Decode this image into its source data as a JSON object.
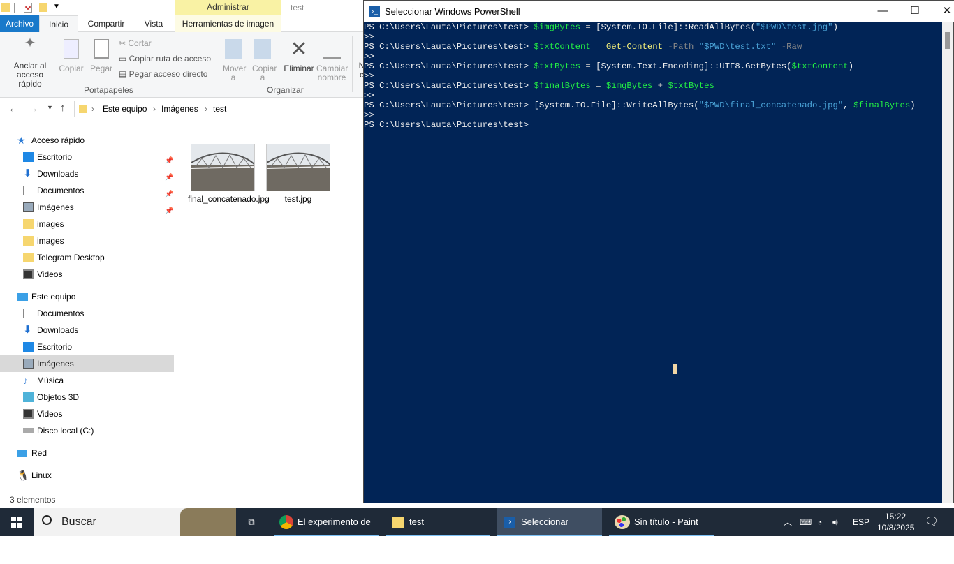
{
  "explorer": {
    "ribbon_context_tab": "Administrar",
    "window_title": "test",
    "tabs": [
      "Archivo",
      "Inicio",
      "Compartir",
      "Vista",
      "Herramientas de imagen"
    ],
    "ribbon": {
      "anclar": "Anclar al acceso rápido",
      "copiar": "Copiar",
      "pegar": "Pegar",
      "cortar": "Cortar",
      "copiar_ruta": "Copiar ruta de acceso",
      "pegar_acceso": "Pegar acceso directo",
      "group_portapapeles": "Portapapeles",
      "mover_a": "Mover a",
      "copiar_a": "Copiar a",
      "eliminar": "Eliminar",
      "cambiar_nombre": "Cambiar nombre",
      "group_organizar": "Organizar",
      "cut_off": "N c"
    },
    "breadcrumb": [
      "Este equipo",
      "Imágenes",
      "test"
    ],
    "nav": {
      "acceso_rapido": "Acceso rápido",
      "quick_items": [
        "Escritorio",
        "Downloads",
        "Documentos",
        "Imágenes",
        "images",
        "images",
        "Telegram Desktop",
        "Videos"
      ],
      "este_equipo": "Este equipo",
      "pc_items": [
        "Documentos",
        "Downloads",
        "Escritorio",
        "Imágenes",
        "Música",
        "Objetos 3D",
        "Videos",
        "Disco local (C:)"
      ],
      "red": "Red",
      "linux": "Linux"
    },
    "files": [
      "final_concatenado.jpg",
      "test.jpg"
    ],
    "status": "3 elementos"
  },
  "powershell": {
    "title": "Seleccionar Windows PowerShell",
    "prompt": "PS C:\\Users\\Lauta\\Pictures\\test>",
    "continuation": ">>",
    "lines": [
      [
        {
          "t": "$imgBytes",
          "c": "var"
        },
        {
          "t": " = ",
          "c": "op"
        },
        {
          "t": "[System.IO.File]::ReadAllBytes(",
          "c": "txt"
        },
        {
          "t": "\"$PWD\\test.jpg\"",
          "c": "str"
        },
        {
          "t": ")",
          "c": "txt"
        }
      ],
      [
        {
          "t": "$txtContent",
          "c": "var"
        },
        {
          "t": " = ",
          "c": "op"
        },
        {
          "t": "Get-Content",
          "c": "cmd"
        },
        {
          "t": " -Path ",
          "c": "par"
        },
        {
          "t": "\"$PWD\\test.txt\"",
          "c": "str"
        },
        {
          "t": " -Raw",
          "c": "par"
        }
      ],
      [
        {
          "t": "$txtBytes",
          "c": "var"
        },
        {
          "t": " = ",
          "c": "op"
        },
        {
          "t": "[System.Text.Encoding]::UTF8.GetBytes(",
          "c": "txt"
        },
        {
          "t": "$txtContent",
          "c": "var"
        },
        {
          "t": ")",
          "c": "txt"
        }
      ],
      [
        {
          "t": "$finalBytes",
          "c": "var"
        },
        {
          "t": " = ",
          "c": "op"
        },
        {
          "t": "$imgBytes",
          "c": "var"
        },
        {
          "t": " + ",
          "c": "op"
        },
        {
          "t": "$txtBytes",
          "c": "var"
        }
      ],
      [
        {
          "t": "[System.IO.File]::WriteAllBytes(",
          "c": "txt"
        },
        {
          "t": "\"$PWD\\final_concatenado.jpg\"",
          "c": "str"
        },
        {
          "t": ", ",
          "c": "txt"
        },
        {
          "t": "$finalBytes",
          "c": "var"
        },
        {
          "t": ")",
          "c": "txt"
        }
      ]
    ]
  },
  "taskbar": {
    "search_placeholder": "Buscar",
    "items": [
      "El experimento de ...",
      "test",
      "Seleccionar Windo...",
      "Sin título - Paint"
    ],
    "lang": "ESP",
    "time": "15:22",
    "date": "10/8/2025"
  },
  "colors": {
    "ps_bg": "#012456",
    "accent": "#1979ca",
    "taskbar": "#1f2a38"
  }
}
